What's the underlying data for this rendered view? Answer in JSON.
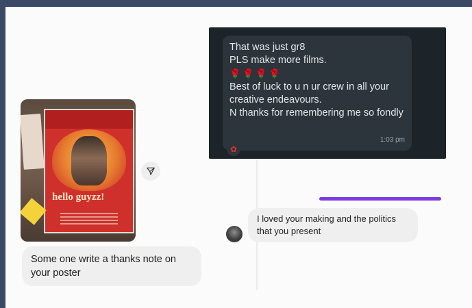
{
  "shared_post": {
    "poster_title": "hello guyzz!",
    "share_icon": "send-arrow-icon"
  },
  "messages": {
    "left": "Some one write a thanks note on your poster",
    "screenshot": {
      "line1": "That was just gr8",
      "line2": "PLS make more films.",
      "emoji_roses": "🌹🌹🌹🌹",
      "line3": "Best of luck to u n ur crew in all your creative endeavours.",
      "line4": "N thanks for remembering me so fondly",
      "time": "1:03 pm",
      "reaction_icon": "rose-reaction-icon"
    },
    "right": "I loved your making and the politics that you present"
  },
  "colors": {
    "frame": "#3a4a66",
    "bubble": "#efefef",
    "screenshot_bg": "#1c2329",
    "accent": "#7c3ae0"
  }
}
